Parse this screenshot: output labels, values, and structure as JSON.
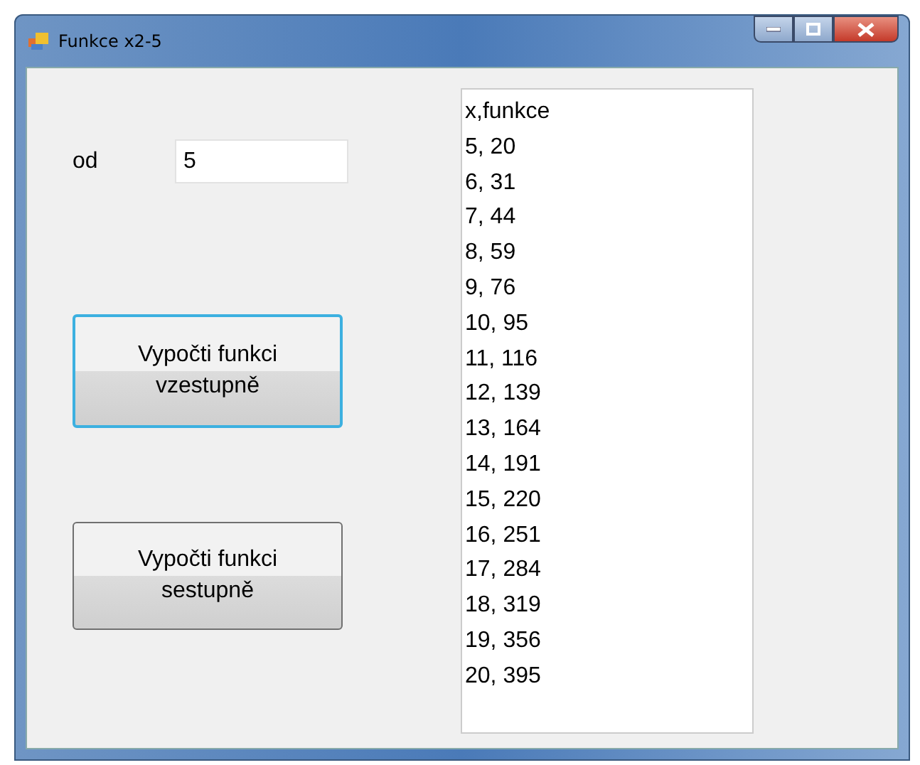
{
  "window": {
    "title": "Funkce x2-5"
  },
  "from_field": {
    "label": "od",
    "value": "5"
  },
  "buttons": [
    {
      "label": "Vypočti funkci vzestupně",
      "focused": true
    },
    {
      "label": "Vypočti funkci sestupně",
      "focused": false
    }
  ],
  "list": {
    "items": [
      "x,funkce",
      "5, 20",
      "6, 31",
      "7, 44",
      "8, 59",
      "9, 76",
      "10, 95",
      "11, 116",
      "12, 139",
      "13, 164",
      "14, 191",
      "15, 220",
      "16, 251",
      "17, 284",
      "18, 319",
      "19, 356",
      "20, 395"
    ]
  }
}
